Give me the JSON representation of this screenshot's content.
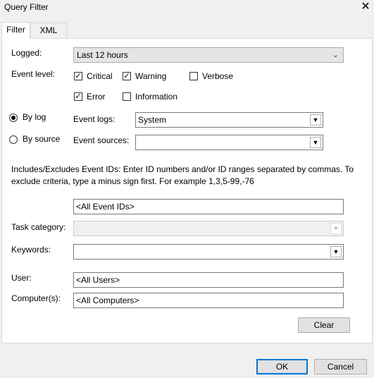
{
  "window": {
    "title": "Query Filter",
    "close_glyph": "✕"
  },
  "tabs": [
    {
      "label": "Filter"
    },
    {
      "label": "XML"
    }
  ],
  "logged": {
    "label": "Logged:",
    "value": "Last 12 hours"
  },
  "event_level": {
    "label": "Event level:",
    "options": [
      {
        "label": "Critical",
        "checked": true
      },
      {
        "label": "Warning",
        "checked": true
      },
      {
        "label": "Verbose",
        "checked": false
      },
      {
        "label": "Error",
        "checked": true
      },
      {
        "label": "Information",
        "checked": false
      }
    ]
  },
  "source_mode": {
    "by_log": {
      "label": "By log",
      "selected": true
    },
    "by_source": {
      "label": "By source",
      "selected": false
    }
  },
  "event_logs": {
    "label": "Event logs:",
    "value": "System"
  },
  "event_sources": {
    "label": "Event sources:",
    "value": ""
  },
  "event_ids": {
    "description": "Includes/Excludes Event IDs: Enter ID numbers and/or ID ranges separated by commas. To exclude criteria, type a minus sign first. For example 1,3,5-99,-76",
    "value": "<All Event IDs>"
  },
  "task_category": {
    "label": "Task category:",
    "value": ""
  },
  "keywords": {
    "label": "Keywords:",
    "value": ""
  },
  "user": {
    "label": "User:",
    "value": "<All Users>"
  },
  "computers": {
    "label": "Computer(s):",
    "value": "<All Computers>"
  },
  "buttons": {
    "clear": "Clear",
    "ok": "OK",
    "cancel": "Cancel"
  },
  "icons": {
    "check": "✓",
    "chevron": "⌄",
    "dropdown": "▼"
  },
  "colors": {
    "accent": "#0078d7",
    "background": "#f0f0f0",
    "panel": "#ffffff"
  }
}
